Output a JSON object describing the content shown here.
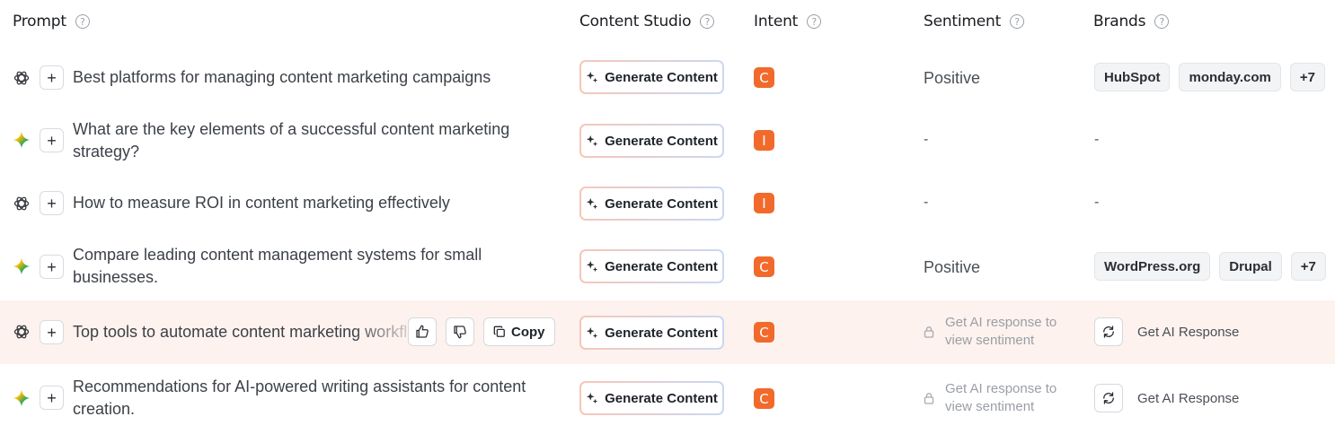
{
  "headers": {
    "prompt": "Prompt",
    "content_studio": "Content Studio",
    "intent": "Intent",
    "sentiment": "Sentiment",
    "brands": "Brands"
  },
  "help_glyph": "?",
  "generate_label": "Generate Content",
  "copy_label": "Copy",
  "get_ai_label": "Get AI Response",
  "locked_sentiment_text": "Get AI response to view sentiment",
  "dash": "-",
  "colors": {
    "intent_badge": "#f26a2b",
    "hover_row": "#fdf2ee"
  },
  "rows": [
    {
      "engine": "chatgpt-icon",
      "prompt": "Best platforms for managing content marketing campaigns",
      "intent": "C",
      "sentiment": "Positive",
      "brands": [
        "HubSpot",
        "monday.com"
      ],
      "brands_more": "+7"
    },
    {
      "engine": "gemini-icon",
      "prompt": "What are the key elements of a successful content marketing strategy?",
      "intent": "I",
      "sentiment": "-",
      "brands_dash": "-"
    },
    {
      "engine": "chatgpt-icon",
      "prompt": "How to measure ROI in content marketing effectively",
      "intent": "I",
      "sentiment": "-",
      "brands_dash": "-"
    },
    {
      "engine": "gemini-icon",
      "prompt": "Compare leading content management systems for small businesses.",
      "intent": "C",
      "sentiment": "Positive",
      "brands": [
        "WordPress.org",
        "Drupal"
      ],
      "brands_more": "+7"
    },
    {
      "engine": "chatgpt-icon",
      "prompt": "Top tools to automate content marketing workflows",
      "intent": "C"
    },
    {
      "engine": "gemini-icon",
      "prompt": "Recommendations for AI-powered writing assistants for content creation.",
      "intent": "C"
    }
  ]
}
